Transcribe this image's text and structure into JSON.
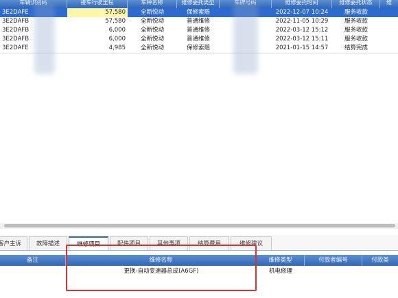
{
  "grid": {
    "columns": [
      "车辆识别码",
      "接车行驶里程",
      "车种名称",
      "维修委托类型",
      "车牌号码",
      "维修委托时间",
      "维修委托状态",
      "维"
    ],
    "rows": [
      {
        "vin": "3E2DAFE",
        "mileage": "57,580",
        "model": "全新悦动",
        "type": "保修索赔",
        "plate": "",
        "time": "2022-12-07 10:24",
        "status": "服务收款",
        "selected": true
      },
      {
        "vin": "3E2DAFB",
        "mileage": "57,580",
        "model": "全新悦动",
        "type": "普通维修",
        "plate": "",
        "time": "2022-11-05 10:29",
        "status": "服务收款",
        "selected": false
      },
      {
        "vin": "3E2DAFB",
        "mileage": "6,000",
        "model": "全新悦动",
        "type": "普通维修",
        "plate": "",
        "time": "2022-03-12 15:12",
        "status": "服务收款",
        "selected": false
      },
      {
        "vin": "3E2DAFB",
        "mileage": "6,000",
        "model": "全新悦动",
        "type": "普通维修",
        "plate": "",
        "time": "2022-03-12 15:11",
        "status": "服务收款",
        "selected": false
      },
      {
        "vin": "3E2DAFE",
        "mileage": "4,985",
        "model": "全新悦动",
        "type": "保修索赔",
        "plate": "",
        "time": "2021-01-15 14:57",
        "status": "结算完成",
        "selected": false
      }
    ]
  },
  "tabs": [
    "客户主诉",
    "故障描述",
    "维修项目",
    "配件项目",
    "其他事项",
    "结算费用",
    "维修建议"
  ],
  "active_tab": "维修项目",
  "bottom_grid": {
    "columns": [
      "备注",
      "维修名称",
      "维修类型",
      "付款者编号",
      "付款类"
    ],
    "row": {
      "remark": "",
      "name": "更换-自动变速器总成(A6GF)",
      "type": "机电修理",
      "payer_no": "",
      "payer_type": ""
    }
  }
}
